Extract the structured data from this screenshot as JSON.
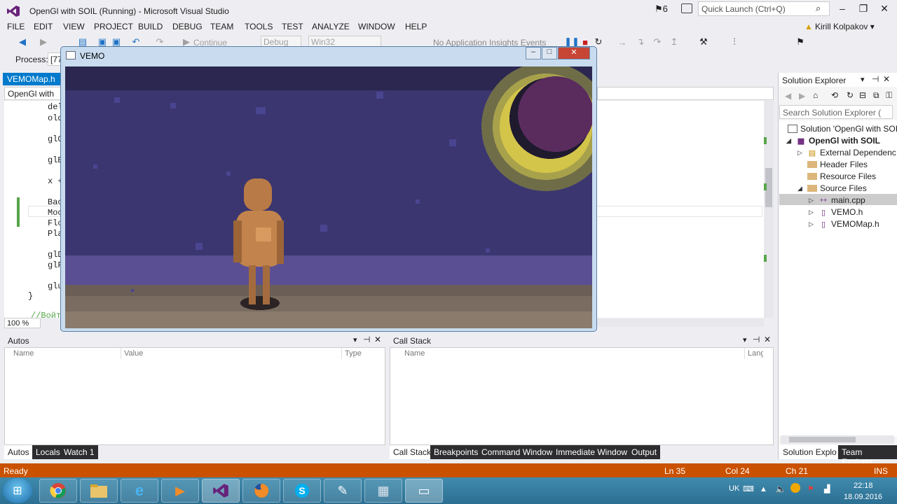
{
  "window": {
    "title": "OpenGl with SOIL (Running) - Microsoft Visual Studio",
    "notifications_count": "6",
    "quick_launch_placeholder": "Quick Launch (Ctrl+Q)"
  },
  "menu": [
    "FILE",
    "EDIT",
    "VIEW",
    "PROJECT",
    "BUILD",
    "DEBUG",
    "TEAM",
    "TOOLS",
    "TEST",
    "ANALYZE",
    "WINDOW",
    "HELP"
  ],
  "user": {
    "name": "Kirill Kolpakov ▾"
  },
  "toolbar": {
    "continue_label": "Continue",
    "config": "Debug",
    "platform": "Win32",
    "insights": "No Application Insights Events",
    "process_label": "Process:",
    "process_value": "[77"
  },
  "editor": {
    "tab_title": "VEMOMap.h",
    "nav_left": "OpenGl with",
    "code_lines": [
      "del",
      "old",
      "glC",
      "glE",
      "x +",
      "Bac",
      "Moc",
      "Flo",
      "Pla",
      "glD",
      "glF",
      "glu",
      "}",
      "//Войт"
    ],
    "zoom": "100 %"
  },
  "vemo": {
    "title": "VEMO"
  },
  "solution_explorer": {
    "title": "Solution Explorer",
    "search_placeholder": "Search Solution Explorer (",
    "items": [
      {
        "label": "Solution 'OpenGl with SOIL"
      },
      {
        "label": "OpenGl with SOIL"
      },
      {
        "label": "External Dependenc"
      },
      {
        "label": "Header Files"
      },
      {
        "label": "Resource Files"
      },
      {
        "label": "Source Files"
      },
      {
        "label": "main.cpp"
      },
      {
        "label": "VEMO.h"
      },
      {
        "label": "VEMOMap.h"
      }
    ],
    "tabs": [
      "Solution Explo...",
      "Team Explorer"
    ]
  },
  "autos": {
    "title": "Autos",
    "columns": [
      "Name",
      "Value",
      "Type"
    ],
    "tabs": [
      "Autos",
      "Locals",
      "Watch 1"
    ]
  },
  "callstack": {
    "title": "Call Stack",
    "columns": [
      "Name",
      "Lang"
    ],
    "tabs": [
      "Call Stack",
      "Breakpoints",
      "Command Window",
      "Immediate Window",
      "Output"
    ]
  },
  "status": {
    "ready": "Ready",
    "line": "Ln 35",
    "col": "Col 24",
    "ch": "Ch 21",
    "mode": "INS"
  },
  "taskbar": {
    "lang": "UK",
    "time": "22:18",
    "date": "18.09.2016"
  },
  "colors": {
    "accent": "#007acc",
    "status_bar": "#ca5100",
    "vs_purple": "#68217a"
  }
}
